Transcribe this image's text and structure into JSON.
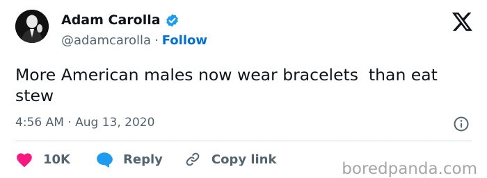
{
  "author": {
    "display_name": "Adam Carolla",
    "handle": "@adamcarolla",
    "follow_label": "Follow",
    "separator": "·"
  },
  "tweet": {
    "text": "More American males now wear bracelets  than eat stew",
    "timestamp": "4:56 AM · Aug 13, 2020"
  },
  "actions": {
    "like_count": "10K",
    "reply_label": "Reply",
    "copy_link_label": "Copy link"
  },
  "icons": {
    "verified": "verified-badge-icon",
    "platform": "x-logo-icon",
    "info": "info-icon",
    "like": "heart-icon",
    "reply": "speech-bubble-icon",
    "copy": "link-icon"
  },
  "colors": {
    "like": "#f91880",
    "reply": "#1d9bf0",
    "follow": "#006fd6",
    "verified": "#1d9bf0",
    "secondary_text": "#536471"
  },
  "watermark": "boredpanda.com"
}
